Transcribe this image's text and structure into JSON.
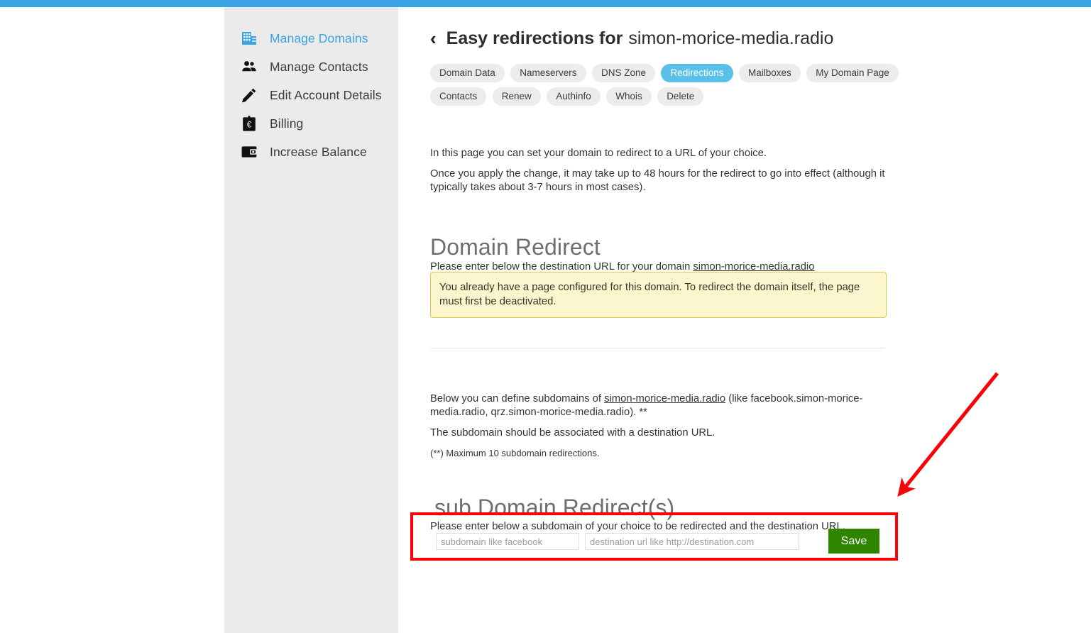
{
  "theme": {
    "accent_blue": "#3aa3e3",
    "active_tab_blue": "#5bc0e8",
    "sidebar_gray": "#ebebeb",
    "save_green": "#2d8500",
    "warning_bg": "#fcf6cf",
    "warning_border": "#e0c84a",
    "annotation_red": "#fb0007"
  },
  "sidebar": {
    "items": [
      {
        "label": "Manage Domains",
        "icon": "building-icon",
        "active": true
      },
      {
        "label": "Manage Contacts",
        "icon": "people-icon",
        "active": false
      },
      {
        "label": "Edit Account Details",
        "icon": "pencil-icon",
        "active": false
      },
      {
        "label": "Billing",
        "icon": "clipboard-euro-icon",
        "active": false
      },
      {
        "label": "Increase Balance",
        "icon": "wallet-icon",
        "active": false
      }
    ]
  },
  "header": {
    "back_icon": "back-chevron-icon",
    "back_glyph": "‹",
    "title_prefix": "Easy redirections for",
    "domain": "simon-morice-media.radio"
  },
  "tabs": [
    {
      "label": "Domain Data",
      "active": false
    },
    {
      "label": "Nameservers",
      "active": false
    },
    {
      "label": "DNS Zone",
      "active": false
    },
    {
      "label": "Redirections",
      "active": true
    },
    {
      "label": "Mailboxes",
      "active": false
    },
    {
      "label": "My Domain Page",
      "active": false
    },
    {
      "label": "Contacts",
      "active": false
    },
    {
      "label": "Renew",
      "active": false
    },
    {
      "label": "Authinfo",
      "active": false
    },
    {
      "label": "Whois",
      "active": false
    },
    {
      "label": "Delete",
      "active": false
    }
  ],
  "intro": {
    "line1": "In this page you can set your domain to redirect to a URL of your choice.",
    "line2": "Once you apply the change, it may take up to 48 hours for the redirect to go into effect (although it typically takes about 3-7 hours in most cases)."
  },
  "domain_redirect": {
    "heading": "Domain Redirect",
    "instruction_prefix": "Please enter below the destination URL for your domain ",
    "instruction_domain": "simon-morice-media.radio",
    "warning": "You already have a page configured for this domain. To redirect the domain itself, the page must first be deactivated."
  },
  "subdomain_info": {
    "line1_prefix": "Below you can define subdomains of ",
    "line1_domain": "simon-morice-media.radio",
    "line1_suffix": " (like facebook.simon-morice-media.radio, qrz.simon-morice-media.radio). **",
    "line2": "The subdomain should be associated with a destination URL.",
    "footnote": "(**) Maximum 10 subdomain redirections."
  },
  "subdomain_redirect": {
    "heading": "sub Domain Redirect(s)",
    "instruction": "Please enter below a subdomain of your choice to be redirected and the destination URL.",
    "subdomain_value": "",
    "subdomain_placeholder": "subdomain like facebook",
    "destination_value": "",
    "destination_placeholder": "destination url like http://destination.com",
    "save_label": "Save"
  },
  "annotations": {
    "highlight_box": "red-rectangle-highlight",
    "arrow": "red-arrow-pointing-to-form"
  }
}
